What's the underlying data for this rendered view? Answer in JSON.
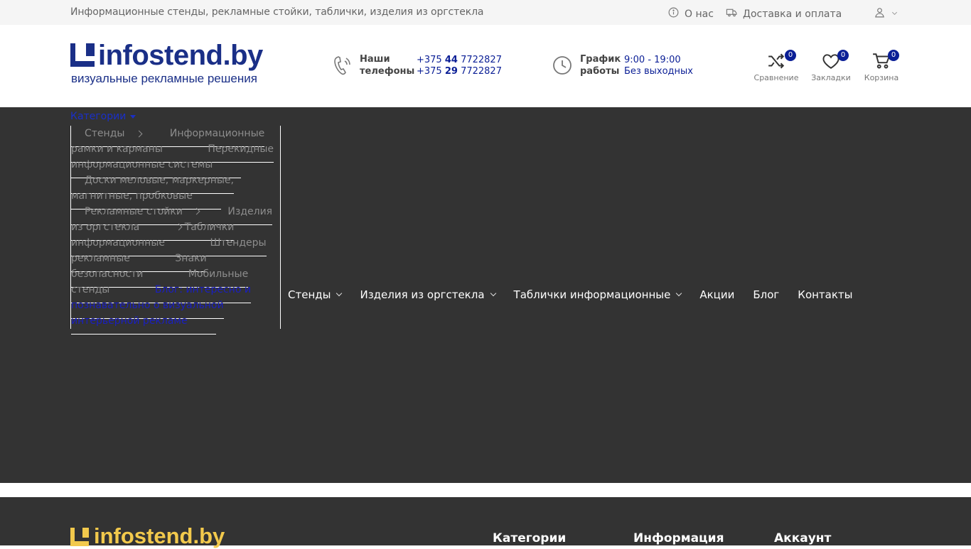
{
  "topbar": {
    "tagline": "Информационные стенды, рекламные стойки, таблички, изделия из оргстекла",
    "about": "О нас",
    "delivery": "Доставка и оплата"
  },
  "header": {
    "logo_name": "infostend.by",
    "logo_slogan": "визуальные рекламные решения",
    "phones_label_1": "Наши",
    "phones_label_2": "телефоны",
    "phone1_prefix": "+375 ",
    "phone1_code": "44",
    "phone1_number": " 7722827",
    "phone2_prefix": "+375 ",
    "phone2_code": "29",
    "phone2_number": " 7722827",
    "schedule_label_1": "График",
    "schedule_label_2": "работы",
    "schedule_hours": "9:00 - 19:00",
    "schedule_days": "Без выходных",
    "compare_label": "Сравнение",
    "compare_count": "0",
    "bookmarks_label": "Закладки",
    "bookmarks_count": "0",
    "cart_label": "Корзина",
    "cart_count": "0"
  },
  "categories": {
    "toggle": "Категории",
    "items": [
      {
        "label": "Стенды"
      },
      {
        "label": "Информационные рамки и карманы"
      },
      {
        "label": "Перекидные информационные системы"
      },
      {
        "label": "Доски меловые, маркерные, магнитные, пробковые"
      },
      {
        "label": "Рекламные стойки"
      },
      {
        "label": "Изделия из оргстекла"
      },
      {
        "label": "Таблички информационные"
      },
      {
        "label": "Штендеры рекламные"
      },
      {
        "label": "Знаки безопасности"
      },
      {
        "label": "Мобильные стенды"
      },
      {
        "label": "Блог: интересно и познавательно о визуальной интерьерной рекламе"
      }
    ]
  },
  "mainnav": {
    "items": [
      {
        "label": "Стенды"
      },
      {
        "label": "Изделия из оргстекла"
      },
      {
        "label": "Таблички информационные"
      },
      {
        "label": "Акции"
      },
      {
        "label": "Блог"
      },
      {
        "label": "Контакты"
      }
    ]
  },
  "footer": {
    "logo_name": "infostend.by",
    "col1": "Категории",
    "col2": "Информация",
    "col3": "Аккаунт"
  },
  "colors": {
    "brand_blue": "#1a2f87",
    "accent_blue": "#0b1f96",
    "dark_band": "#333333",
    "footer_logo": "#f2c94c"
  }
}
